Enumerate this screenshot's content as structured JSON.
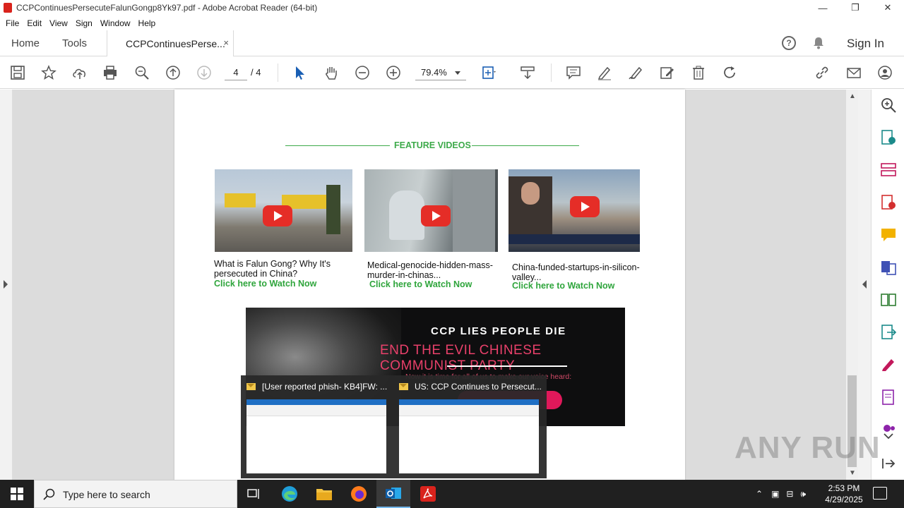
{
  "window": {
    "title": "CCPContinuesPersecuteFalunGongp8Yk97.pdf - Adobe Acrobat Reader (64-bit)",
    "controls": [
      "—",
      "❐",
      "✕"
    ]
  },
  "menu": [
    "File",
    "Edit",
    "View",
    "Sign",
    "Window",
    "Help"
  ],
  "tabs": {
    "home": "Home",
    "tools": "Tools",
    "doc": "CCPContinuesPerse...",
    "close": "×",
    "sign_in": "Sign In",
    "help": "?"
  },
  "toolbar": {
    "page_current": "4",
    "page_total": "/ 4",
    "zoom": "79.4%"
  },
  "document": {
    "feature_title": "FEATURE VIDEOS",
    "videos": [
      {
        "title": "What is Falun Gong? Why It's persecuted in China?",
        "link": "Click here to Watch Now"
      },
      {
        "title": "Medical-genocide-hidden-mass-murder-in-chinas...",
        "link": "Click here to Watch Now"
      },
      {
        "title": "China-funded-startups-in-silicon-valley...",
        "link": "Click here to Watch Now"
      }
    ],
    "banner": {
      "line1": "CCP LIES PEOPLE DIE",
      "line2": "END THE EVIL CHINESE COMMUNIST PARTY",
      "line3": "Now it is time for all of us to make our voice heard:"
    }
  },
  "thumbnails": [
    {
      "title": "[User reported phish- KB4]FW: ..."
    },
    {
      "title": "US: CCP Continues to Persecut..."
    }
  ],
  "watermark": "ANY RUN",
  "taskbar": {
    "search_placeholder": "Type here to search",
    "time": "2:53 PM",
    "date": "4/29/2025"
  },
  "colors": {
    "accent_green": "#3daa4a",
    "banner_pink": "#e8406a",
    "acrobat_red": "#d9231c",
    "taskbar": "#202020"
  }
}
